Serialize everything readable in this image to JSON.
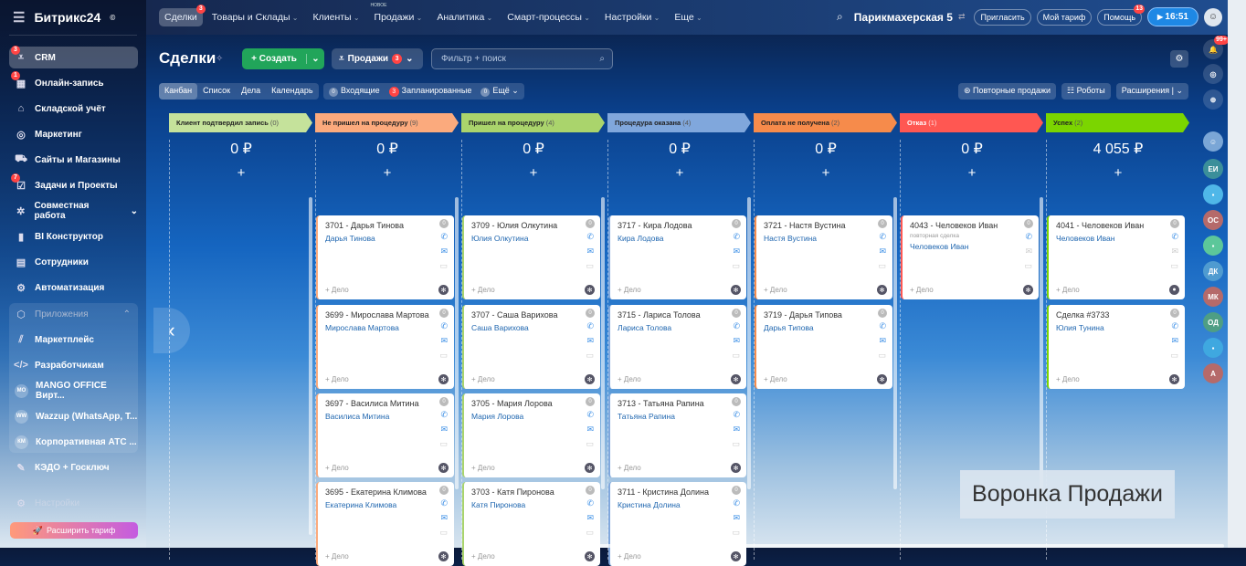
{
  "app": {
    "name": "Битрикс24",
    "mark": "©"
  },
  "sidebar": {
    "items": [
      {
        "label": "CRM",
        "icon": "funnel-icon",
        "badge": "3",
        "active": true
      },
      {
        "label": "Онлайн-запись",
        "icon": "calendar-icon",
        "badge": "1"
      },
      {
        "label": "Складской учёт",
        "icon": "warehouse-icon"
      },
      {
        "label": "Маркетинг",
        "icon": "target-icon"
      },
      {
        "label": "Сайты и Магазины",
        "icon": "cart-icon"
      },
      {
        "label": "Задачи и Проекты",
        "icon": "tasks-icon",
        "badge": "7"
      },
      {
        "label": "Совместная работа",
        "icon": "collab-icon",
        "chevron": "⌄"
      },
      {
        "label": "BI Конструктор",
        "icon": "chart-icon"
      },
      {
        "label": "Сотрудники",
        "icon": "people-icon"
      },
      {
        "label": "Автоматизация",
        "icon": "robot-icon"
      }
    ],
    "apps_title": "Приложения",
    "apps": [
      {
        "label": "Маркетплейс",
        "icon": "marketplace-icon"
      },
      {
        "label": "Разработчикам",
        "icon": "code-icon"
      },
      {
        "label": "MANGO OFFICE Вирт...",
        "initials": "MO"
      },
      {
        "label": "Wazzup (WhatsApp, T...",
        "initials": "WW"
      },
      {
        "label": "Корпоративная АТС ...",
        "initials": "КМ"
      }
    ],
    "kedo": "КЭДО + Госключ",
    "settings": "Настройки",
    "upgrade": "Расширить тариф"
  },
  "topnav": {
    "items": [
      {
        "label": "Сделки",
        "badge": "3",
        "active": true
      },
      {
        "label": "Товары и Склады",
        "chev": true
      },
      {
        "label": "Клиенты",
        "chev": true
      },
      {
        "label": "Продажи",
        "chev": true,
        "new": "НОВОЕ"
      },
      {
        "label": "Аналитика",
        "chev": true
      },
      {
        "label": "Смарт-процессы",
        "chev": true
      },
      {
        "label": "Настройки",
        "chev": true
      },
      {
        "label": "Еще",
        "chev": true
      }
    ],
    "company": "Парикмахерская 5",
    "invite": "Пригласить",
    "tariff": "Мой тариф",
    "help": "Помощь",
    "help_badge": "13",
    "time": "16:51"
  },
  "page": {
    "title": "Сделки",
    "create": "Создать",
    "pipeline": "Продажи",
    "pipeline_badge": "3",
    "search_placeholder": "Фильтр + поиск",
    "views": [
      "Канбан",
      "Список",
      "Дела",
      "Календарь"
    ],
    "counters": [
      {
        "n": "0",
        "label": "Входящие",
        "red": false
      },
      {
        "n": "3",
        "label": "Запланированные",
        "red": true
      },
      {
        "n": "0",
        "label": "Ещё",
        "red": false
      }
    ],
    "actions": [
      "Повторные продажи",
      "Роботы",
      "Расширения"
    ],
    "funnel_label": "Воронка Продажи"
  },
  "rail": {
    "notif_badge": "99+",
    "avatars": [
      {
        "t": "ЕИ",
        "c": "#3b8f9a"
      },
      {
        "t": "",
        "c": "#4fb7e8"
      },
      {
        "t": "ОС",
        "c": "#b56a6a"
      },
      {
        "t": "",
        "c": "#5cc79a"
      },
      {
        "t": "ДК",
        "c": "#4f9bd0"
      },
      {
        "t": "МК",
        "c": "#b56a6a"
      },
      {
        "t": "ОД",
        "c": "#4e9e84"
      },
      {
        "t": "",
        "c": "#3fa8e0"
      },
      {
        "t": "А",
        "c": "#b56a6a"
      }
    ]
  },
  "columns": [
    {
      "title": "Клиент подтвердил запись",
      "count": "(0)",
      "color": "#c5e29b",
      "sum": "0 ₽",
      "cards": []
    },
    {
      "title": "Не пришел на процедуру",
      "count": "(9)",
      "color": "#fbaa7d",
      "sum": "0 ₽",
      "cards": [
        {
          "t": "3701 - Дарья Тинова",
          "c": "Дарья Тинова"
        },
        {
          "t": "3699 - Мирослава Мартова",
          "c": "Мирослава Мартова"
        },
        {
          "t": "3697 - Василиса Митина",
          "c": "Василиса Митина"
        },
        {
          "t": "3695 - Екатерина Климова",
          "c": "Екатерина Климова"
        }
      ]
    },
    {
      "title": "Пришел на процедуру",
      "count": "(4)",
      "color": "#aad46c",
      "sum": "0 ₽",
      "cards": [
        {
          "t": "3709 - Юлия Олкутина",
          "c": "Юлия Олкутина"
        },
        {
          "t": "3707 - Саша Варихова",
          "c": "Саша Варихова"
        },
        {
          "t": "3705 - Мария Лорова",
          "c": "Мария Лорова"
        },
        {
          "t": "3703 - Катя Пиронова",
          "c": "Катя Пиронова"
        }
      ]
    },
    {
      "title": "Процедура оказана",
      "count": "(4)",
      "color": "#80a7dc",
      "sum": "0 ₽",
      "cards": [
        {
          "t": "3717 - Кира Лодова",
          "c": "Кира Лодова"
        },
        {
          "t": "3715 - Лариса Толова",
          "c": "Лариса Толова"
        },
        {
          "t": "3713 - Татьяна Рапина",
          "c": "Татьяна Рапина"
        },
        {
          "t": "3711 - Кристина Долина",
          "c": "Кристина Долина"
        }
      ]
    },
    {
      "title": "Оплата не получена",
      "count": "(2)",
      "color": "#f68b4b",
      "sum": "0 ₽",
      "cards": [
        {
          "t": "3721 - Настя Вустина",
          "c": "Настя Вустина"
        },
        {
          "t": "3719 - Дарья Типова",
          "c": "Дарья Типова"
        }
      ]
    },
    {
      "title": "Отказ",
      "count": "(1)",
      "color": "#ff5752",
      "light": true,
      "sum": "0 ₽",
      "cards": [
        {
          "t": "4043 - Человеков Иван",
          "c": "Человеков Иван",
          "rep": "повторная сделка"
        }
      ]
    },
    {
      "title": "Успех",
      "count": "(2)",
      "color": "#7bd500",
      "sum": "4 055 ₽",
      "cards": [
        {
          "t": "4041 - Человеков Иван",
          "c": "Человеков Иван",
          "user": true
        },
        {
          "t": "Сделка #3733",
          "c": "Юлия Тунина"
        }
      ]
    }
  ],
  "card_labels": {
    "counter": "0",
    "add_deal": "+ Дело"
  }
}
